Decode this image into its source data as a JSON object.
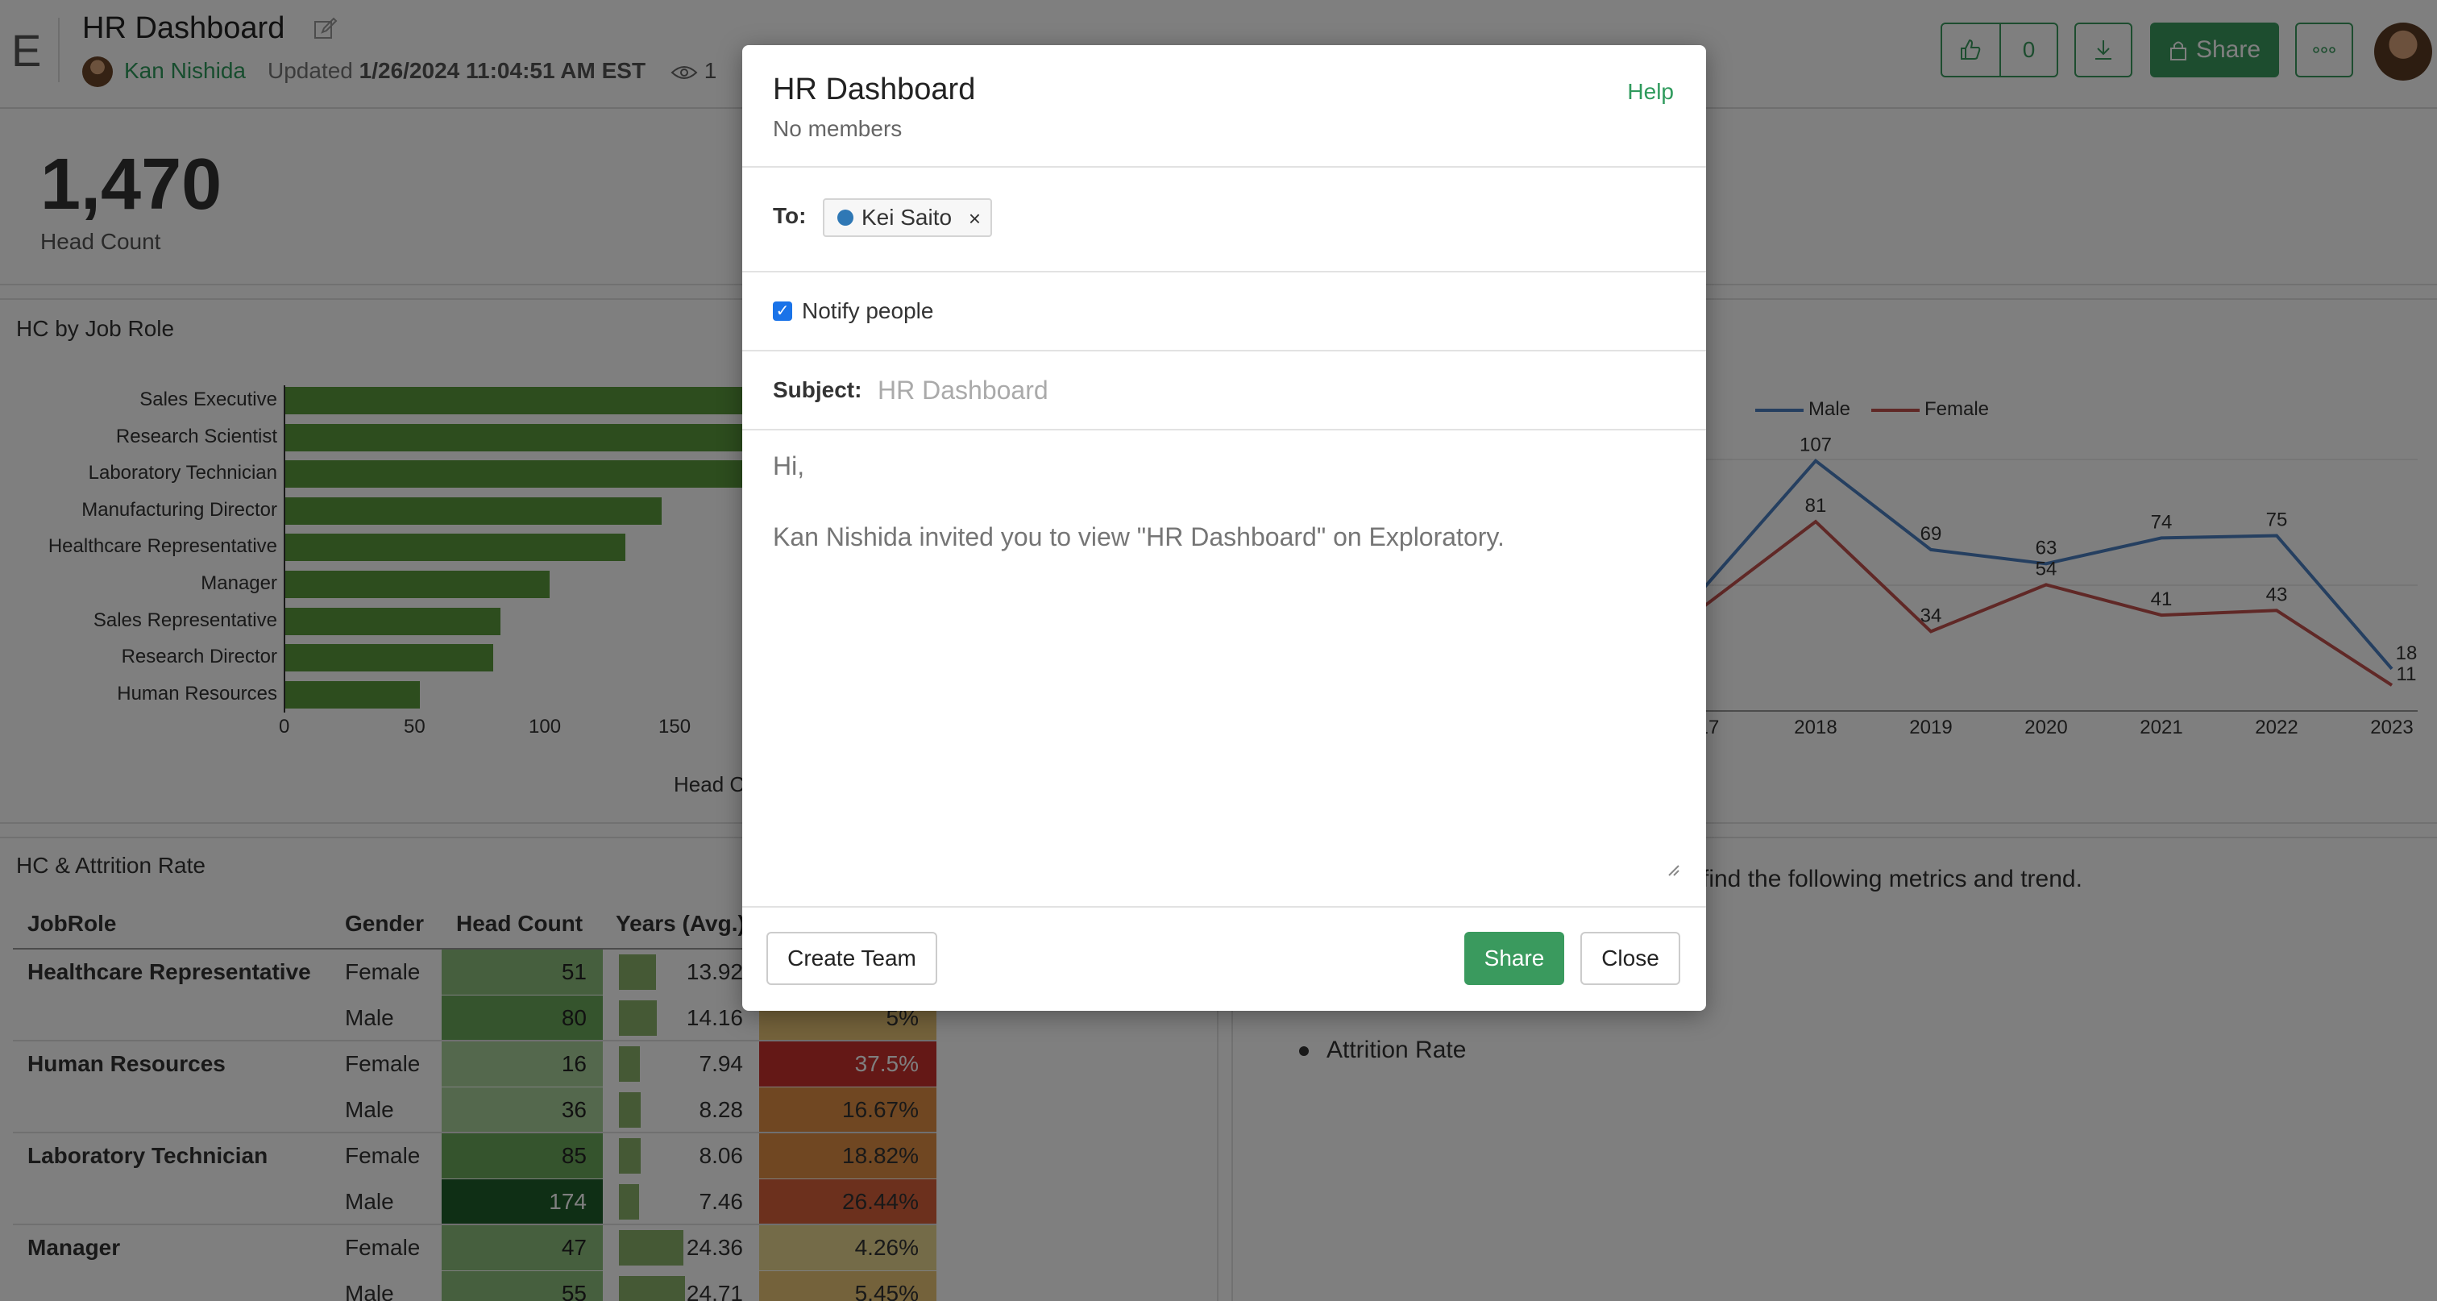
{
  "header": {
    "logo_letter": "E",
    "title": "HR Dashboard",
    "owner": "Kan Nishida",
    "updated_prefix": "Updated",
    "updated_time": "1/26/2024 11:04:51 AM EST",
    "view_count": "1",
    "like_count": "0",
    "share_label": "Share"
  },
  "kpi": {
    "value": "1,470",
    "label": "Head Count"
  },
  "bar_panel": {
    "title": "HC by Job Role",
    "x_axis_title": "Head C",
    "x_ticks": [
      "0",
      "50",
      "100",
      "150"
    ],
    "chart_data": {
      "type": "bar",
      "orientation": "horizontal",
      "categories": [
        "Sales Executive",
        "Research Scientist",
        "Laboratory Technician",
        "Manufacturing Director",
        "Healthcare Representative",
        "Manager",
        "Sales Representative",
        "Research Director",
        "Human Resources"
      ],
      "values": [
        326,
        292,
        259,
        145,
        131,
        102,
        83,
        80,
        52
      ],
      "xlim": [
        0,
        180
      ],
      "xlabel": "Head C"
    }
  },
  "line_panel": {
    "legend": [
      {
        "name": "Male",
        "color": "#4a7fc1"
      },
      {
        "name": "Female",
        "color": "#c0504d"
      }
    ],
    "x_ticks": [
      "17",
      "2018",
      "2019",
      "2020",
      "2021",
      "2022",
      "2023"
    ],
    "chart_data": {
      "type": "line",
      "x": [
        "2018",
        "2019",
        "2020",
        "2021",
        "2022",
        "2023"
      ],
      "series": [
        {
          "name": "Male",
          "values": [
            107,
            69,
            63,
            74,
            75,
            18
          ]
        },
        {
          "name": "Female",
          "values": [
            81,
            34,
            54,
            41,
            43,
            11
          ]
        }
      ],
      "labels_male": [
        "107",
        "69",
        "63",
        "74",
        "75",
        "18"
      ],
      "labels_female": [
        "81",
        "34",
        "54",
        "41",
        "43",
        "11"
      ]
    }
  },
  "table_panel": {
    "title": "HC & Attrition Rate",
    "columns": [
      "JobRole",
      "Gender",
      "Head Count",
      "Years (Avg.)"
    ],
    "rows": [
      {
        "role": "Healthcare Representative",
        "gender": "Female",
        "hc": "51",
        "years": "13.92",
        "attr": ""
      },
      {
        "role": "",
        "gender": "Male",
        "hc": "80",
        "years": "14.16",
        "attr": "5%"
      },
      {
        "role": "Human Resources",
        "gender": "Female",
        "hc": "16",
        "years": "7.94",
        "attr": "37.5%"
      },
      {
        "role": "",
        "gender": "Male",
        "hc": "36",
        "years": "8.28",
        "attr": "16.67%"
      },
      {
        "role": "Laboratory Technician",
        "gender": "Female",
        "hc": "85",
        "years": "8.06",
        "attr": "18.82%"
      },
      {
        "role": "",
        "gender": "Male",
        "hc": "174",
        "years": "7.46",
        "attr": "26.44%"
      },
      {
        "role": "Manager",
        "gender": "Female",
        "hc": "47",
        "years": "24.36",
        "attr": "4.26%"
      },
      {
        "role": "",
        "gender": "Male",
        "hc": "55",
        "years": "24.71",
        "attr": "5.45%"
      }
    ]
  },
  "notes": {
    "text": "find the following metrics and trend.",
    "bullet": "Attrition Rate"
  },
  "modal": {
    "title": "HR Dashboard",
    "subtitle": "No members",
    "help": "Help",
    "to_label": "To:",
    "recipient": "Kei Saito",
    "remove_glyph": "×",
    "notify_label": "Notify people",
    "notify_checked": true,
    "subject_label": "Subject:",
    "subject_placeholder": "HR Dashboard",
    "message_placeholder": "Hi,\n\nKan Nishida invited you to view \"HR Dashboard\" on Exploratory.",
    "create_team": "Create Team",
    "share": "Share",
    "close": "Close"
  },
  "colors": {
    "accent_green": "#3a9a5e",
    "bar_green": "#5a9a3c",
    "recipient_dot": "#2f78b5",
    "checkbox_blue": "#1a73e8"
  }
}
